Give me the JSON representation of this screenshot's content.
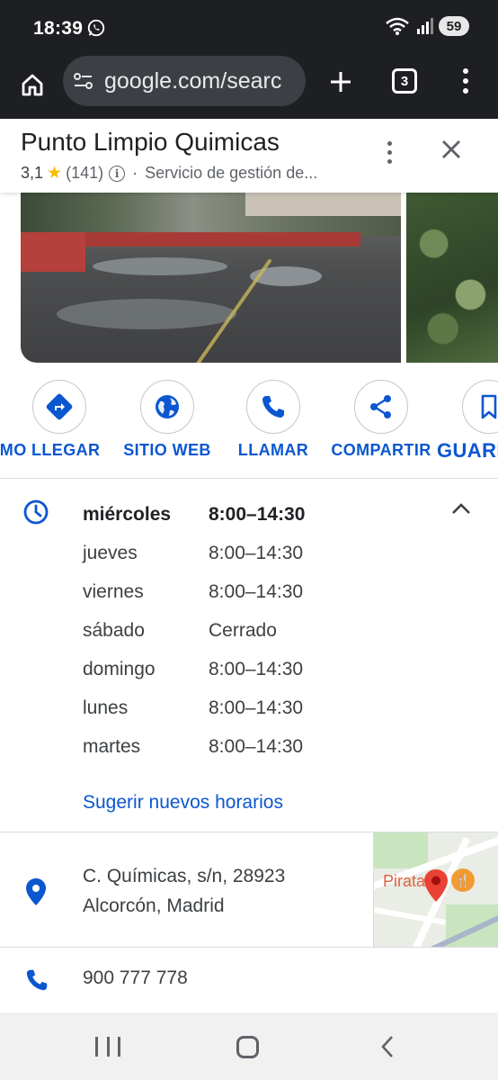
{
  "status_bar": {
    "time": "18:39",
    "battery": "59",
    "wifi_label": "5"
  },
  "browser": {
    "url": "google.com/searc",
    "tab_count": "3"
  },
  "place": {
    "title": "Punto Limpio Quimicas",
    "rating": "3,1",
    "review_count": "(141)",
    "category": "Servicio de gestión de...",
    "separator": "·"
  },
  "actions": [
    {
      "label": "CÓMO LLEGAR",
      "icon": "directions-icon"
    },
    {
      "label": "SITIO WEB",
      "icon": "globe-icon"
    },
    {
      "label": "LLAMAR",
      "icon": "phone-icon"
    },
    {
      "label": "COMPARTIR",
      "icon": "share-icon"
    },
    {
      "label": "GUARDAR",
      "icon": "bookmark-icon"
    }
  ],
  "hours": {
    "rows": [
      {
        "day": "miércoles",
        "time": "8:00–14:30"
      },
      {
        "day": "jueves",
        "time": "8:00–14:30"
      },
      {
        "day": "viernes",
        "time": "8:00–14:30"
      },
      {
        "day": "sábado",
        "time": "Cerrado"
      },
      {
        "day": "domingo",
        "time": "8:00–14:30"
      },
      {
        "day": "lunes",
        "time": "8:00–14:30"
      },
      {
        "day": "martes",
        "time": "8:00–14:30"
      }
    ],
    "suggest_link": "Sugerir nuevos horarios"
  },
  "address": {
    "line1": "C. Químicas, s/n, 28923",
    "line2": "Alcorcón, Madrid",
    "map_label": "Pirata"
  },
  "phone": {
    "number": "900 777 778"
  },
  "colors": {
    "accent": "#0b57d0",
    "bar": "#1e1f22",
    "star": "#fbbc04"
  }
}
